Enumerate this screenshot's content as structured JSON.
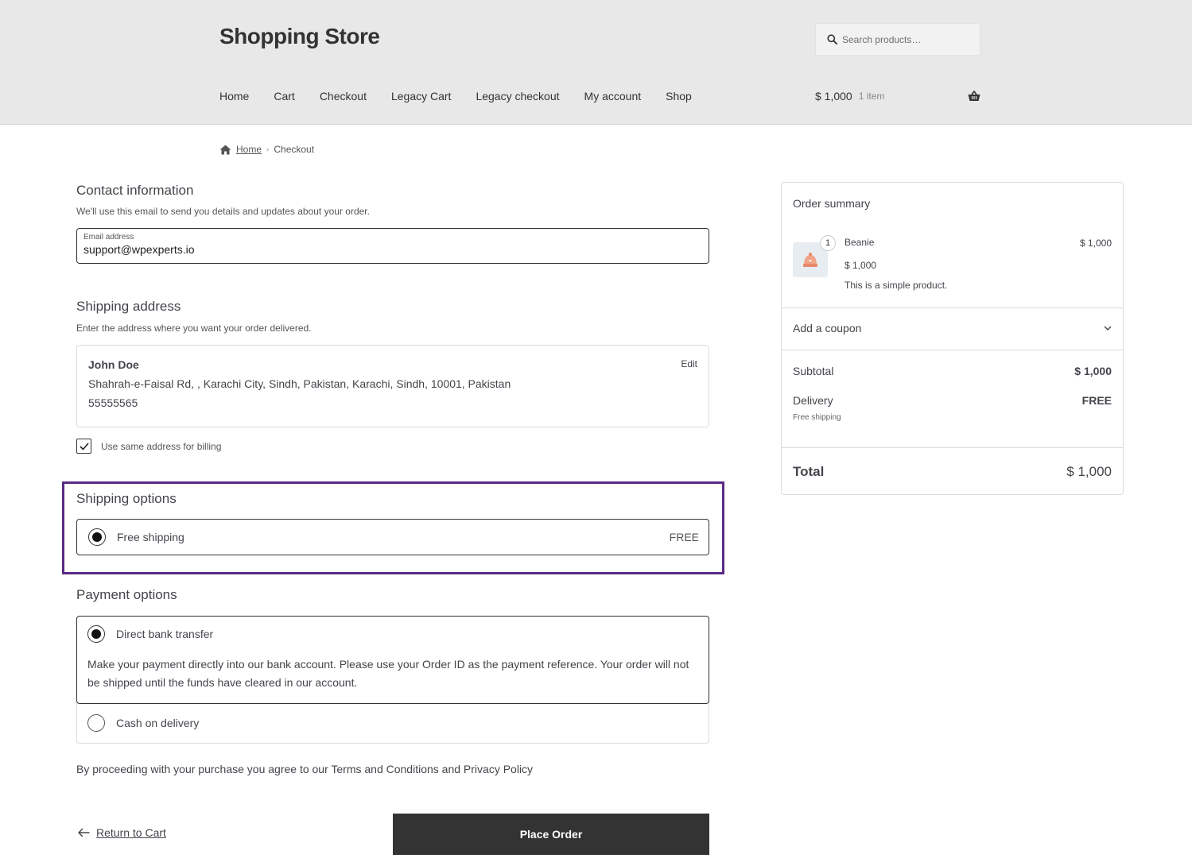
{
  "header": {
    "site_title": "Shopping Store",
    "search_placeholder": "Search products…",
    "nav": [
      "Home",
      "Cart",
      "Checkout",
      "Legacy Cart",
      "Legacy checkout",
      "My account",
      "Shop"
    ],
    "cart_total": "$ 1,000",
    "cart_count": "1 item"
  },
  "breadcrumb": {
    "home": "Home",
    "current": "Checkout"
  },
  "contact": {
    "title": "Contact information",
    "description": "We'll use this email to send you details and updates about your order.",
    "email_label": "Email address",
    "email_value": "support@wpexperts.io"
  },
  "shipping_address": {
    "title": "Shipping address",
    "description": "Enter the address where you want your order delivered.",
    "name": "John Doe",
    "address": "Shahrah-e-Faisal Rd, , Karachi City, Sindh, Pakistan, Karachi, Sindh, 10001, Pakistan",
    "phone": "55555565",
    "edit_label": "Edit",
    "billing_same_label": "Use same address for billing"
  },
  "shipping_options": {
    "title": "Shipping options",
    "option_label": "Free shipping",
    "option_price": "FREE"
  },
  "payment_options": {
    "title": "Payment options",
    "bank_label": "Direct bank transfer",
    "bank_description": "Make your payment directly into our bank account. Please use your Order ID as the payment reference. Your order will not be shipped until the funds have cleared in our account.",
    "cod_label": "Cash on delivery"
  },
  "terms_text": "By proceeding with your purchase you agree to our Terms and Conditions and Privacy Policy",
  "actions": {
    "return_label": "Return to Cart",
    "place_order_label": "Place Order"
  },
  "summary": {
    "title": "Order summary",
    "item": {
      "quantity": "1",
      "name": "Beanie",
      "line_total": "$ 1,000",
      "price": "$ 1,000",
      "description": "This is a simple product."
    },
    "coupon_label": "Add a coupon",
    "subtotal_label": "Subtotal",
    "subtotal_value": "$ 1,000",
    "delivery_label": "Delivery",
    "delivery_value": "FREE",
    "delivery_method": "Free shipping",
    "total_label": "Total",
    "total_value": "$ 1,000"
  },
  "colors": {
    "header_bg": "#e8e8e8",
    "highlight_border": "#5b2a86",
    "button_bg": "#333333"
  }
}
